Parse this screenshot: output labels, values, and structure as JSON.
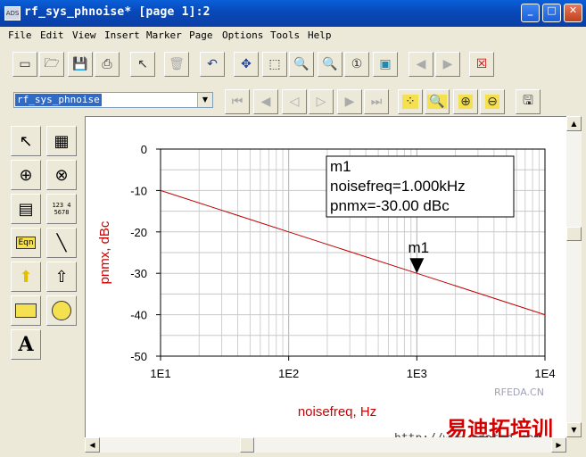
{
  "window": {
    "title": "rf_sys_phnoise* [page 1]:2"
  },
  "menu": [
    "File",
    "Edit",
    "View",
    "Insert",
    "Marker",
    "Page",
    "Options",
    "Tools",
    "Help"
  ],
  "design_selector": {
    "value": "rf_sys_phnoise"
  },
  "marker": {
    "label": "m1",
    "lines": [
      "m1",
      "noisefreq=1.000kHz",
      "pnmx=-30.00 dBc"
    ],
    "x": 1000,
    "y": -30
  },
  "chart_data": {
    "type": "line",
    "xlabel": "noisefreq, Hz",
    "ylabel": "pnmx, dBc",
    "xscale": "log",
    "xlim": [
      10,
      10000
    ],
    "ylim": [
      -50,
      0
    ],
    "xticks": [
      "1E1",
      "1E2",
      "1E3",
      "1E4"
    ],
    "yticks": [
      "0",
      "-10",
      "-20",
      "-30",
      "-40",
      "-50"
    ],
    "grid": true,
    "series": [
      {
        "x": [
          10,
          100,
          1000,
          10000
        ],
        "y": [
          -10,
          -20,
          -30,
          -40
        ],
        "color": "#c00000"
      }
    ]
  },
  "watermark": {
    "text1": "RFEDA.CN",
    "text2": "易迪拓培训",
    "text3": "http://www.edatop.com"
  },
  "colors": {
    "titlebar": "#0a5fd8",
    "axis_label": "#cc0000",
    "trace": "#c00000"
  }
}
